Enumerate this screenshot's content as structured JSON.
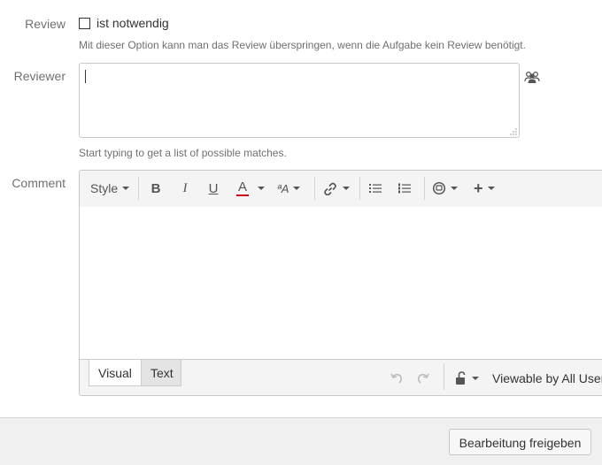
{
  "review": {
    "label": "Review",
    "checkbox_label": "ist notwendig",
    "checked": false,
    "hint": "Mit dieser Option kann man das Review überspringen, wenn die Aufgabe kein Review benötigt."
  },
  "reviewer": {
    "label": "Reviewer",
    "value": "",
    "icon": "users-icon",
    "hint": "Start typing to get a list of possible matches."
  },
  "comment": {
    "label": "Comment",
    "toolbar": {
      "style_label": "Style",
      "bold": "B",
      "italic": "I",
      "underline": "U",
      "text_color": "A",
      "text_color_accent": "#d0021b",
      "more_formatting": "ªA"
    },
    "tabs": [
      {
        "label": "Visual",
        "active": true
      },
      {
        "label": "Text",
        "active": false
      }
    ],
    "viewable_label": "Viewable by All Users"
  },
  "footer": {
    "submit_label": "Bearbeitung freigeben"
  }
}
